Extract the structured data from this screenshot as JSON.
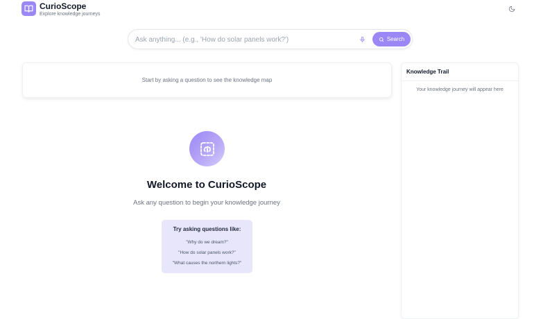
{
  "header": {
    "title": "CurioScope",
    "subtitle": "Explore knowledge journeys",
    "logo_icon": "book-open-icon",
    "theme_icon": "moon-icon"
  },
  "search": {
    "placeholder": "Ask anything... (e.g., 'How do solar panels work?')",
    "value": "",
    "mic_icon": "mic-icon",
    "button_label": "Search",
    "button_icon": "search-icon"
  },
  "map_card": {
    "message": "Start by asking a question to see the knowledge map"
  },
  "welcome": {
    "icon": "brain-scan-icon",
    "title": "Welcome to CurioScope",
    "subtitle": "Ask any question to begin your knowledge journey",
    "suggestions_heading": "Try asking questions like:",
    "suggestions": [
      "\"Why do we dream?\"",
      "\"How do solar panels work?\"",
      "\"What causes the northern lights?\""
    ]
  },
  "trail": {
    "title": "Knowledge Trail",
    "empty_message": "Your knowledge journey will appear here"
  },
  "colors": {
    "accent": "#9b87f5",
    "suggestions_bg": "#e8e6fb"
  }
}
